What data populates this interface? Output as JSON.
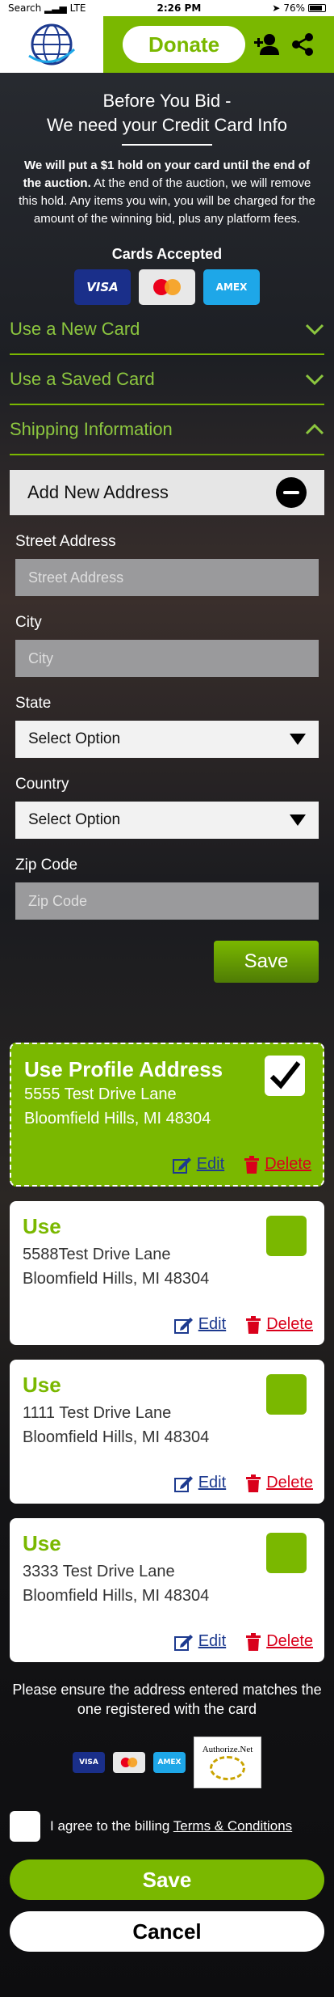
{
  "status_bar": {
    "carrier": "Search",
    "network": "LTE",
    "time": "2:26 PM",
    "battery": "76%",
    "battery_level": 0.76
  },
  "header": {
    "donate_label": "Donate",
    "icons": [
      "globe-logo-icon",
      "add-user-icon",
      "share-icon"
    ]
  },
  "intro": {
    "title_line1": "Before You Bid -",
    "title_line2": "We need your Credit Card Info",
    "bold_text": "We will put a $1 hold on your card until the end of the auction.",
    "body_text": " At the end of the auction, we will remove this hold.  Any items you win, you will be charged for the amount of the winning bid, plus any platform fees."
  },
  "cards_accepted": {
    "label": "Cards Accepted",
    "cards": [
      "VISA",
      "MasterCard",
      "AMEX"
    ]
  },
  "sections": [
    {
      "label": "Use a New Card",
      "expanded": false
    },
    {
      "label": "Use a Saved Card",
      "expanded": false
    },
    {
      "label": "Shipping Information",
      "expanded": true
    }
  ],
  "add_address": {
    "title": "Add New Address",
    "fields": {
      "street_label": "Street Address",
      "street_placeholder": "Street Address",
      "city_label": "City",
      "city_placeholder": "City",
      "state_label": "State",
      "state_value": "Select Option",
      "country_label": "Country",
      "country_value": "Select Option",
      "zip_label": "Zip Code",
      "zip_placeholder": "Zip Code"
    },
    "save_label": "Save"
  },
  "addresses": [
    {
      "title": "Use Profile Address",
      "line1": "5555 Test Drive Lane",
      "line2": "Bloomfield Hills, MI 48304",
      "checked": true
    },
    {
      "title": "Use",
      "line1": "5588Test Drive Lane",
      "line2": "Bloomfield Hills, MI 48304",
      "checked": false
    },
    {
      "title": "Use",
      "line1": "1111 Test Drive Lane",
      "line2": "Bloomfield Hills, MI 48304",
      "checked": false
    },
    {
      "title": "Use",
      "line1": "3333 Test Drive Lane",
      "line2": "Bloomfield Hills, MI 48304",
      "checked": false
    }
  ],
  "actions": {
    "edit": "Edit",
    "delete": "Delete"
  },
  "ensure_text": "Please ensure the address entered matches the one registered with the card",
  "footer_cards": [
    "VISA",
    "MasterCard",
    "AMEX"
  ],
  "authorize_net": "Authorize.Net",
  "agree": {
    "prefix": "I agree to the billing ",
    "link": "Terms & Conditions"
  },
  "buttons": {
    "save": "Save",
    "cancel": "Cancel"
  },
  "colors": {
    "accent": "#7ab800",
    "edit": "#1d3a8f",
    "delete": "#d9001b"
  }
}
